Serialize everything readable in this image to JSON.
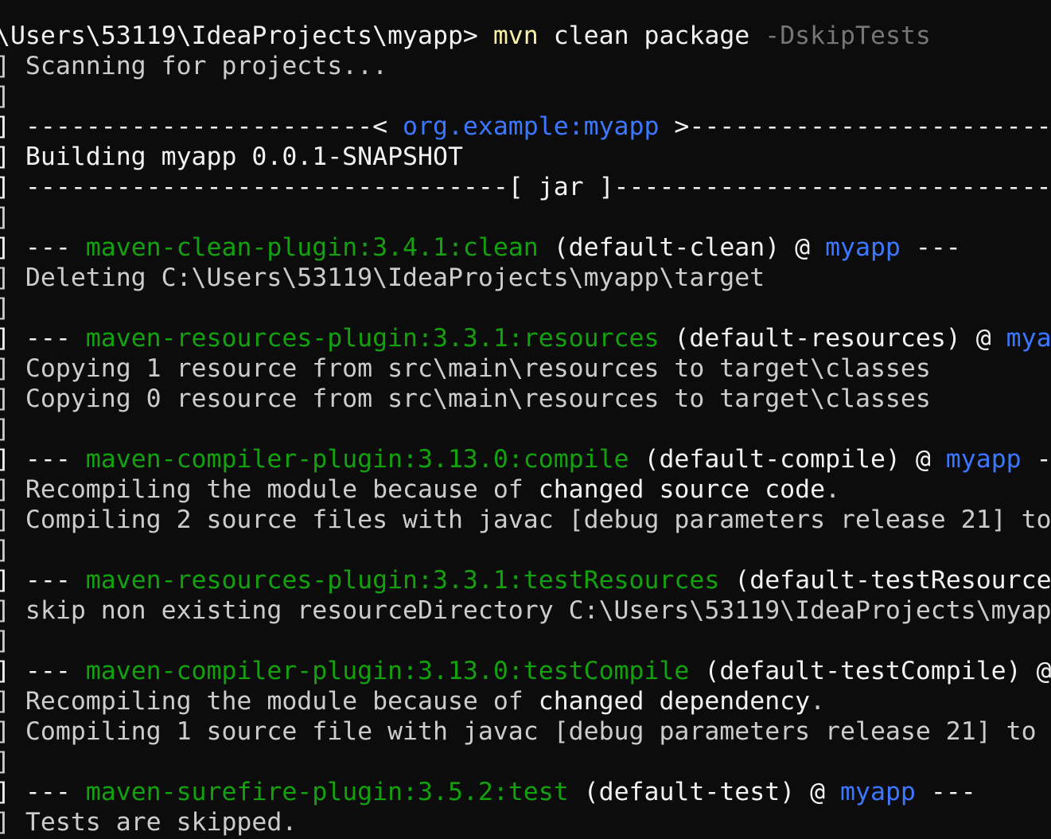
{
  "colors": {
    "background": "#0c0c0c",
    "text": "#cccccc",
    "bright_text": "#f2f2f2",
    "command": "#f9f1a5",
    "option": "#767676",
    "plugin": "#13a10e",
    "artifact": "#3b78ff"
  },
  "prompt": {
    "path": "\\Users\\53119\\IdeaProjects\\myapp> ",
    "command": "mvn",
    "args": " clean package ",
    "option": "-DskipTests"
  },
  "lines": {
    "scanning": "] Scanning for projects...",
    "blank": "]",
    "proj_prefix": "] -----------------------< ",
    "proj_coord": "org.example:myapp",
    "proj_suffix": " >------------------------",
    "building": "] Building myapp 0.0.1-SNAPSHOT",
    "jar_sep": "] --------------------------------[ jar ]---------------------------------",
    "dashes": "] --- ",
    "clean_plugin": "maven-clean-plugin:3.4.1:clean",
    "clean_exec": " (default-clean) @ ",
    "artifact": "myapp",
    "trail": " ---",
    "deleting": "] Deleting C:\\Users\\53119\\IdeaProjects\\myapp\\target",
    "res_plugin": "maven-resources-plugin:3.3.1:resources",
    "res_exec": " (default-resources) @ ",
    "res_artifact": "mya",
    "copy1": "] Copying 1 resource from src\\main\\resources to target\\classes",
    "copy0": "] Copying 0 resource from src\\main\\resources to target\\classes",
    "comp_plugin": "maven-compiler-plugin:3.13.0:compile",
    "comp_exec": " (default-compile) @ ",
    "comp_trail": " -",
    "recompile_src_a": "] Recompiling the module because of ",
    "recompile_src_b": "changed source code",
    "period": ".",
    "compiling2": "] Compiling 2 source files with javac [debug parameters release 21] to",
    "testres_plugin": "maven-resources-plugin:3.3.1:testResources",
    "testres_exec": " (default-testResource",
    "skip": "] skip non existing resourceDirectory C:\\Users\\53119\\IdeaProjects\\myap",
    "testcomp_plugin": "maven-compiler-plugin:3.13.0:testCompile",
    "testcomp_exec": " (default-testCompile) @",
    "recompile_dep_a": "] Recompiling the module because of ",
    "recompile_dep_b": "changed dependency",
    "compiling1": "] Compiling 1 source file with javac [debug parameters release 21] to",
    "surefire_plugin": "maven-surefire-plugin:3.5.2:test",
    "surefire_exec": " (default-test) @ ",
    "skipped": "] Tests are skipped."
  }
}
